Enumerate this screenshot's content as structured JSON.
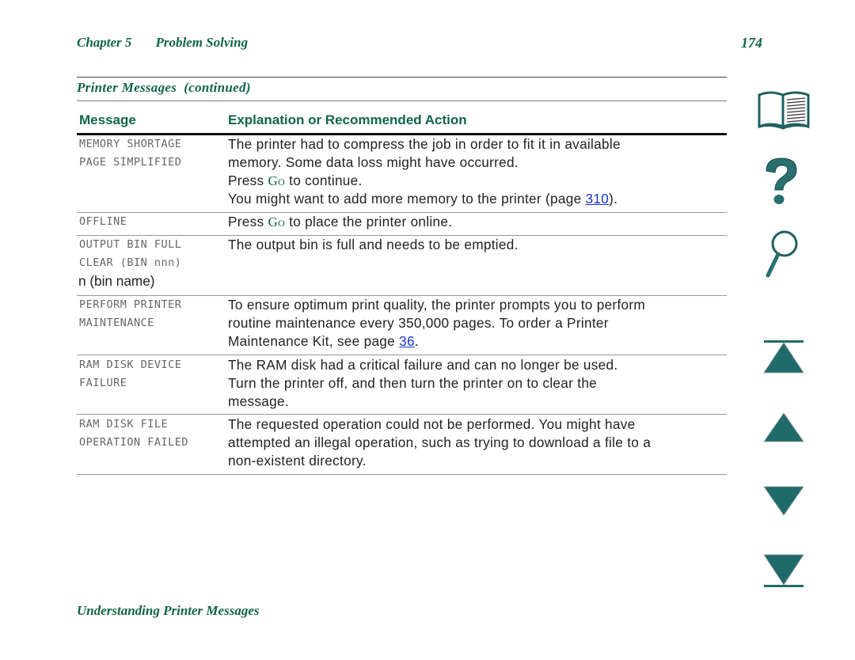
{
  "header": {
    "chapter": "Chapter 5",
    "chapter_title": "Problem Solving",
    "page_number": "174"
  },
  "table": {
    "title": "Printer Messages  (continued)",
    "columns": [
      "Message",
      "Explanation or Recommended Action"
    ],
    "rows": [
      {
        "message": [
          "MEMORY SHORTAGE",
          "PAGE SIMPLIFIED"
        ],
        "lines": [
          "The printer had to compress the job in order to fit it in available",
          "memory. Some data loss might have occurred."
        ],
        "go_line": {
          "pre": "Press ",
          "key": "Go",
          "post": " to continue."
        },
        "link_line": {
          "pre": "You might want to add more memory to the printer (page ",
          "link": "310",
          "post": ")."
        }
      },
      {
        "message": [
          "OFFLINE"
        ],
        "go_line": {
          "pre": "Press ",
          "key": "Go",
          "post": " to place the printer online."
        }
      },
      {
        "message": [
          "OUTPUT BIN FULL",
          "CLEAR (BIN nnn)"
        ],
        "message_extra": "n (bin name)",
        "lines": [
          "The output bin is full and needs to be emptied."
        ]
      },
      {
        "message": [
          "PERFORM PRINTER",
          "MAINTENANCE"
        ],
        "lines": [
          "To ensure optimum print quality, the printer prompts you to perform",
          "routine maintenance every 350,000 pages. To order a Printer"
        ],
        "link_line": {
          "pre": "Maintenance Kit, see page ",
          "link": "36",
          "post": "."
        }
      },
      {
        "message": [
          "RAM DISK DEVICE",
          "FAILURE"
        ],
        "lines": [
          "The RAM disk had a critical failure and can no longer be used.",
          "Turn the printer off, and then turn the printer on to clear the",
          "message."
        ]
      },
      {
        "message": [
          "RAM DISK FILE",
          "OPERATION FAILED"
        ],
        "lines": [
          "The requested operation could not be performed. You might have",
          "attempted an illegal operation, such as trying to download a file to a",
          "non-existent directory."
        ]
      }
    ]
  },
  "footer": {
    "section": "Understanding Printer Messages"
  },
  "nav": {
    "icons": [
      "book-icon",
      "help-icon",
      "search-icon",
      "first-page-icon",
      "previous-page-icon",
      "next-page-icon",
      "last-page-icon"
    ],
    "color": "#1f6b6b"
  }
}
